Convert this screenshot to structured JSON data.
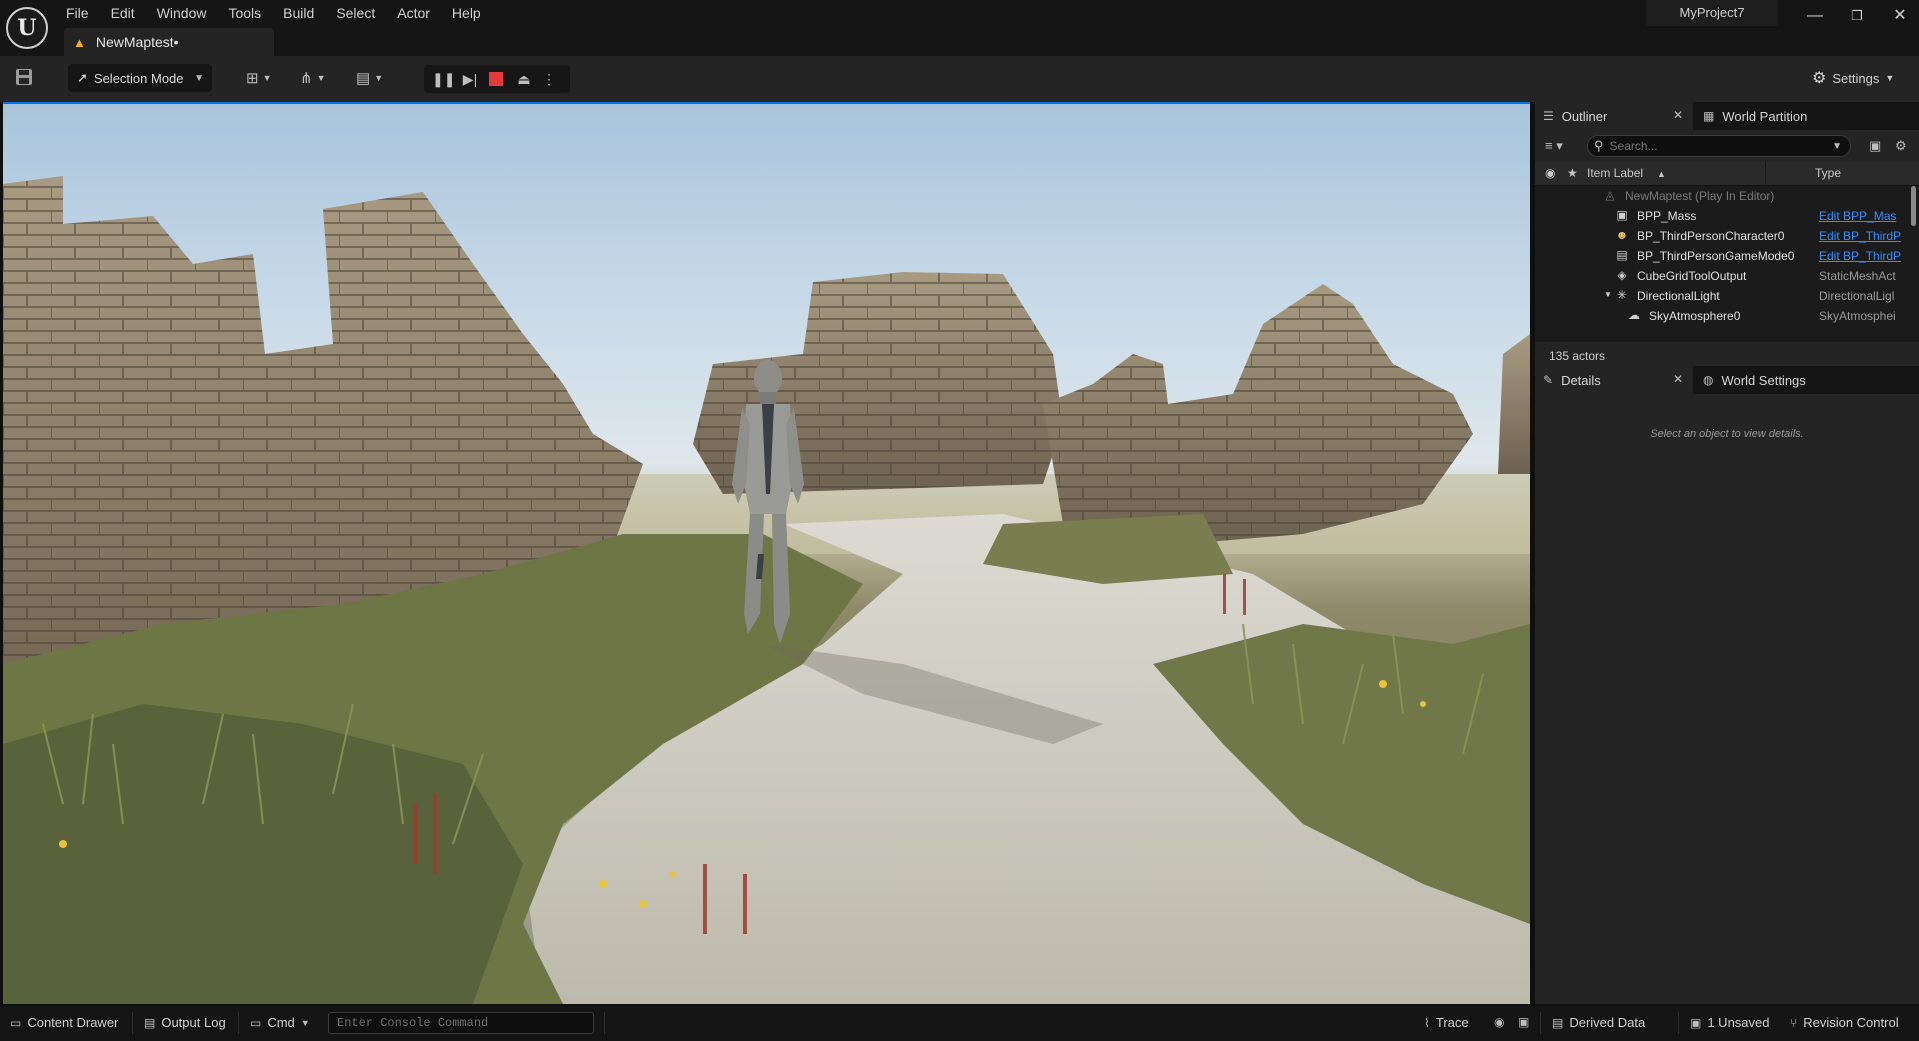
{
  "window": {
    "logo_letter": "U",
    "project_name": "MyProject7",
    "minimize_glyph": "—",
    "restore_glyph": "❐",
    "close_glyph": "✕"
  },
  "menu": [
    "File",
    "Edit",
    "Window",
    "Tools",
    "Build",
    "Select",
    "Actor",
    "Help"
  ],
  "level_tab": {
    "label": "NewMaptest•",
    "icon": "warning-triangle-icon"
  },
  "toolbar": {
    "save_icon": "save-icon",
    "mode_label": "Selection Mode",
    "play_controls": [
      "pause-icon",
      "step-icon",
      "stop-icon",
      "eject-icon",
      "more-options-icon"
    ],
    "stop_color": "#e33b3b",
    "settings_label": "Settings"
  },
  "outliner": {
    "tab_label": "Outliner",
    "partition_tab_label": "World Partition",
    "search_placeholder": "Search...",
    "column_label": "Item Label",
    "column_type": "Type",
    "rows": [
      {
        "label": "NewMaptest (Play In Editor)",
        "type": "",
        "dim": true
      },
      {
        "label": "BPP_Mass",
        "type": "Edit BPP_Mas",
        "link": true
      },
      {
        "label": "BP_ThirdPersonCharacter0",
        "type": "Edit BP_ThirdP",
        "link": true
      },
      {
        "label": "BP_ThirdPersonGameMode0",
        "type": "Edit BP_ThirdP",
        "link": true
      },
      {
        "label": "CubeGridToolOutput",
        "type": "StaticMeshAct",
        "link": false
      },
      {
        "label": "DirectionalLight",
        "type": "DirectionalLigl",
        "link": false
      },
      {
        "label": "SkyAtmosphere0",
        "type": "SkyAtmosphei",
        "link": false
      }
    ],
    "actor_count": "135 actors"
  },
  "details": {
    "tab_label": "Details",
    "world_settings_tab_label": "World Settings",
    "hint": "Select an object to view details."
  },
  "statusbar": {
    "content_drawer": "Content Drawer",
    "output_log": "Output Log",
    "cmd_label": "Cmd",
    "console_placeholder": "Enter Console Command",
    "trace_label": "Trace",
    "derived_data": "Derived Data",
    "unsaved": "1 Unsaved",
    "revision_control": "Revision Control"
  },
  "colors": {
    "accent_blue": "#0074e0",
    "link_blue": "#2f8fff",
    "warning": "#f2b21b"
  }
}
